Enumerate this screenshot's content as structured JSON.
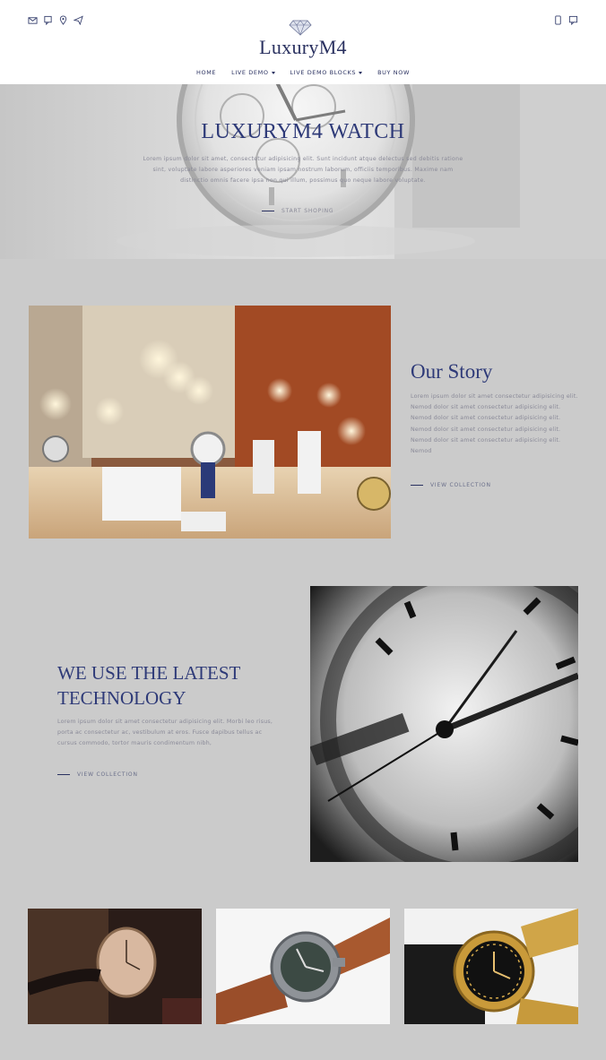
{
  "header": {
    "brand": "LuxuryM4",
    "left_icons": [
      "mail-icon",
      "mobile-icon",
      "location-icon",
      "send-icon"
    ],
    "right_icons": [
      "phone-icon",
      "chat-icon"
    ],
    "nav": [
      {
        "label": "HOME",
        "dropdown": false
      },
      {
        "label": "LIVE DEMO",
        "dropdown": true
      },
      {
        "label": "LIVE DEMO BLOCKS",
        "dropdown": true
      },
      {
        "label": "BUY NOW",
        "dropdown": false
      }
    ]
  },
  "hero": {
    "title": "LUXURYM4 WATCH",
    "text": "Lorem ipsum dolor sit amet, consectetur adipisicing elit. Sunt incidunt atque delectus sed debitis ratione sint, voluptate labore asperiores veniam ipsam nostrum laborum, officiis temporibus. Maxime nam distinctio omnis facere ipsa non qui illum, possimus quo neque labore voluptate.",
    "cta": "START SHOPING"
  },
  "story": {
    "title": "Our Story",
    "text": "Lorem ipsum dolor sit amet consectetur adipisicing elit. Nemod dolor sit amet consectetur adipisicing elit. Nemod dolor sit amet consectetur adipisicing elit. Nemod dolor sit amet consectetur adipisicing elit. Nemod dolor sit amet consectetur adipisicing elit. Nemod",
    "cta": "VIEW COLLECTION"
  },
  "technology": {
    "title": "WE USE THE LATEST TECHNOLOGY",
    "text": "Lorem ipsum dolor sit amet consectetur adipisicing elit. Morbi leo risus, porta ac consectetur ac, vestibulum at eros. Fusce dapibus tellus ac cursus commodo, tortor mauris condimentum nibh,",
    "cta": "VIEW COLLECTION"
  },
  "colors": {
    "accent": "#2e3a78",
    "page_bg": "#cbcbcb",
    "header_bg": "#ffffff",
    "muted_text": "#8a8a98"
  }
}
